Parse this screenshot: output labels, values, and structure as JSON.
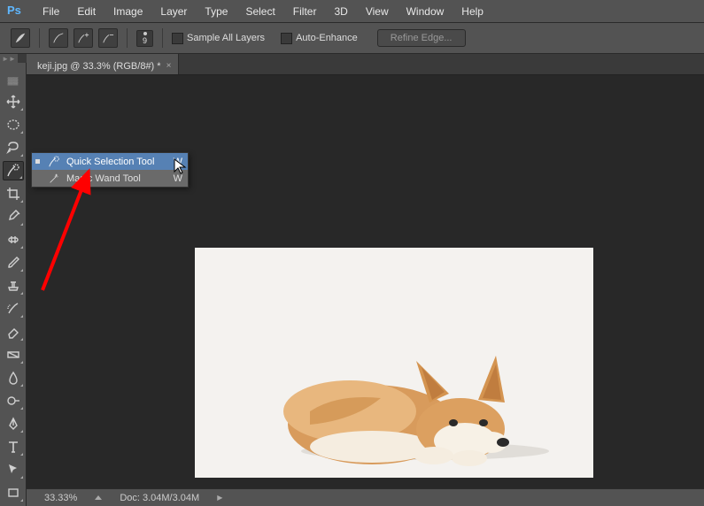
{
  "menu": {
    "items": [
      "File",
      "Edit",
      "Image",
      "Layer",
      "Type",
      "Select",
      "Filter",
      "3D",
      "View",
      "Window",
      "Help"
    ]
  },
  "options": {
    "brush_size": "9",
    "sample_all_layers": "Sample All Layers",
    "auto_enhance": "Auto-Enhance",
    "refine_edge": "Refine Edge..."
  },
  "tab": {
    "title": "keji.jpg @ 33.3% (RGB/8#) *"
  },
  "flyout": {
    "items": [
      {
        "label": "Quick Selection Tool",
        "key": "W",
        "selected": true
      },
      {
        "label": "Magic Wand Tool",
        "key": "W",
        "selected": false
      }
    ]
  },
  "status": {
    "zoom": "33.33%",
    "doc": "Doc: 3.04M/3.04M"
  }
}
